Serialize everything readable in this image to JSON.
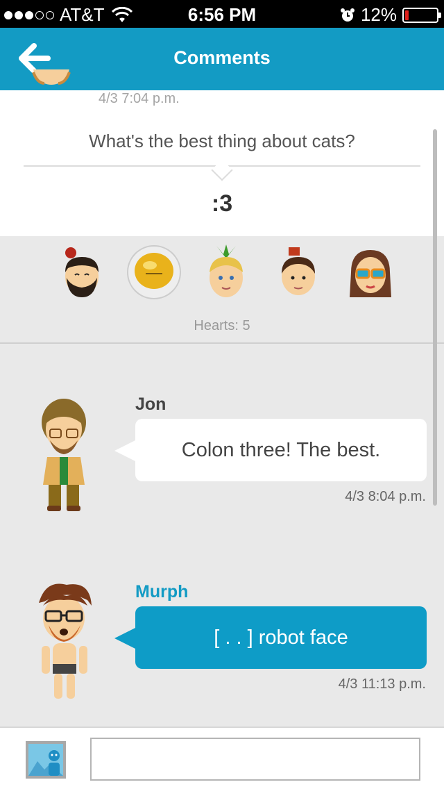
{
  "status_bar": {
    "carrier": "AT&T",
    "signal_filled": 3,
    "signal_total": 5,
    "time": "6:56 PM",
    "battery": "12%",
    "battery_level": 0.12,
    "battery_color": "#e0201b"
  },
  "header": {
    "title": "Comments",
    "background": "#139bc4"
  },
  "post": {
    "date": "4/3 7:04 p.m.",
    "question": "What's the best thing about cats?",
    "answer": ":3"
  },
  "hearts": {
    "label": "Hearts: 5",
    "avatars": [
      "mii-bearded-icon",
      "mii-astronaut-icon",
      "mii-pineapple-icon",
      "mii-crown-icon",
      "mii-sunglasses-icon"
    ]
  },
  "comments": [
    {
      "name": "Jon",
      "text": "Colon three! The best.",
      "date": "4/3 8:04 p.m.",
      "style": "white"
    },
    {
      "name": "Murph",
      "text": "[ . . ] robot face",
      "date": "4/3 11:13 p.m.",
      "style": "blue",
      "name_color": "#139bc4"
    }
  ],
  "composer": {
    "photo_icon": "photo-icon",
    "input_value": "",
    "input_placeholder": ""
  }
}
